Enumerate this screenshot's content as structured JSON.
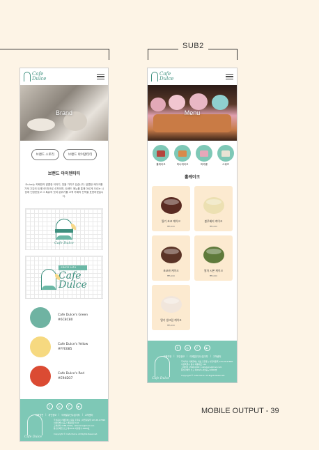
{
  "page": {
    "sub_label": "SUB2",
    "output_label": "MOBILE OUTPUT - 39"
  },
  "shared": {
    "logo_line1": "Cafe",
    "logo_line2": "Dulce"
  },
  "brand_screen": {
    "hero_title": "Brand",
    "tabs": [
      "브랜드 스토리",
      "브랜드 아이덴티티"
    ],
    "section_title": "브랜드 아이덴티티",
    "paragraph": "Dulce는 카페만의 달콤한 이야기, 맛을 가지고 있습니다. 달콤한 케이크를 가게 고유의 트레이드마크로 선보이며, 트렌드 메뉴를 통해 아르게 오르는 시장에 인정받았고 그 특유의 맛과 분위기를 고객 카페의 전역을 표현하겠습니다.",
    "emblem_caption": "Cafe Dulce",
    "big_logo_tag": "SINCE 2019",
    "big_logo_line1": "Cafe",
    "big_logo_line2": "Dulce",
    "swatches": [
      {
        "name": "Cafe Dulce's Green",
        "hex": "#6C8C80",
        "color": "#6fb3a2"
      },
      {
        "name": "Cafe Dulce's Yellow",
        "hex": "#FFE085",
        "color": "#f6d980"
      },
      {
        "name": "Cafe Dulce's Red",
        "hex": "#E94D37",
        "color": "#db4b33"
      }
    ]
  },
  "menu_screen": {
    "hero_title": "Menu",
    "categories": [
      {
        "label": "홀케이크",
        "tint": "#b5453d"
      },
      {
        "label": "미니케이크",
        "tint": "#d98a4a"
      },
      {
        "label": "마카롱",
        "tint": "#e7a7b9"
      },
      {
        "label": "스위츠",
        "tint": "#e9e3d4"
      },
      {
        "label": "",
        "tint": "#b06a3f"
      }
    ],
    "section_title": "홀케이크",
    "cakes": [
      {
        "name": "딸기 초코 케이크",
        "price": "₩5,000",
        "color": "#5a2b22"
      },
      {
        "name": "블루베리 케이크",
        "price": "₩5,000",
        "color": "#ece0b2"
      },
      {
        "name": "초코바 케이크",
        "price": "₩5,000",
        "color": "#5b3427"
      },
      {
        "name": "말차 시폰 케이크",
        "price": "₩5,000",
        "color": "#5f7a3b"
      },
      {
        "name": "딸기 생크림 케이크",
        "price": "₩5,000",
        "color": "#f1e6dc"
      }
    ]
  },
  "footer": {
    "icons": [
      "twitter-icon",
      "instagram-icon",
      "facebook-icon",
      "youtube-icon"
    ],
    "icon_glyphs": [
      "t",
      "◎",
      "f",
      "▶"
    ],
    "links": [
      "이용약관",
      "개인정보",
      "이메일무단수집거부",
      "고객센터"
    ],
    "info_lines": [
      "주식회사 카페둘체 | 대표 홍길동 | 사업자등록 123-45-67890",
      "서울특별시 중구 세종대로 110",
      "고객센터 1588-0000 | cafedulce@mail.com",
      "통신판매업 신고 제2024-서울중구-0000호"
    ],
    "copyright": "Copyright © Cafe Dulce. All Rights Reserved.",
    "mark_text": "Cafe Dulce"
  }
}
